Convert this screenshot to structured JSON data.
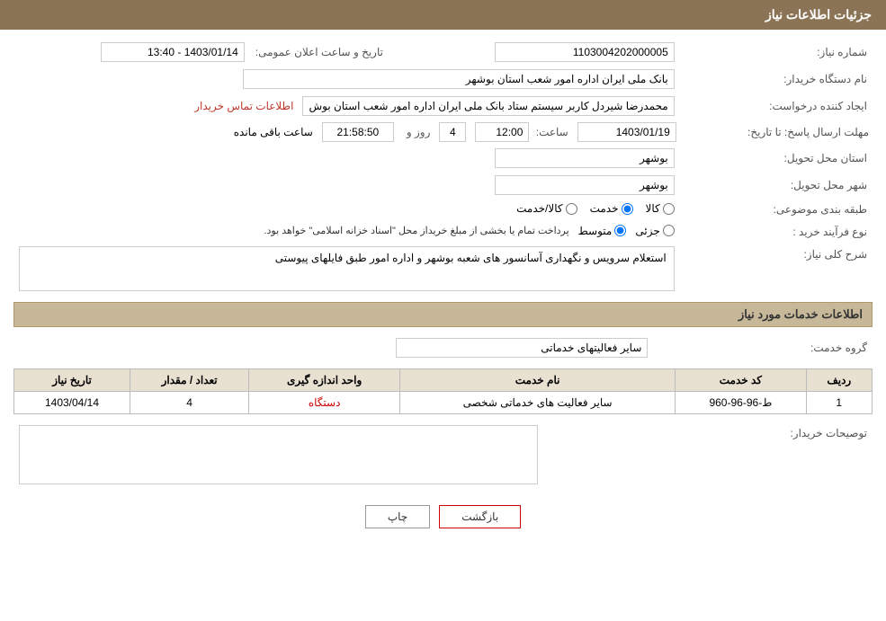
{
  "header": {
    "title": "جزئیات اطلاعات نیاز"
  },
  "fields": {
    "shomareNiaz_label": "شماره نیاز:",
    "shomareNiaz_value": "1103004202000005",
    "namDastgah_label": "نام دستگاه خریدار:",
    "namDastgah_value": "بانک ملی ایران اداره امور شعب استان بوشهر",
    "tarikhoSaat_label": "تاریخ و ساعت اعلان عمومی:",
    "tarikhoSaat_value": "1403/01/14 - 13:40",
    "ijadKonande_label": "ایجاد کننده درخواست:",
    "ijadKonande_value": "محمدرضا شیردل کاربر سیستم ستاد بانک ملی ایران اداره امور شعب استان بوش",
    "ijadKonande_link": "اطلاعات تماس خریدار",
    "mohlat_label": "مهلت ارسال پاسخ: تا تاریخ:",
    "mohlat_date": "1403/01/19",
    "mohlat_saat_label": "ساعت:",
    "mohlat_saat": "12:00",
    "mohlat_rooz_label": "روز و",
    "mohlat_rooz": "4",
    "mohlat_mande_label": "ساعت باقی مانده",
    "mohlat_mande": "21:58:50",
    "ostan_label": "استان محل تحویل:",
    "ostan_value": "بوشهر",
    "shahr_label": "شهر محل تحویل:",
    "shahr_value": "بوشهر",
    "tabaqeBandi_label": "طبقه بندی موضوعی:",
    "tabaqe_kala": "کالا",
    "tabaqe_khadamat": "خدمت",
    "tabaqe_kalaKhadamat": "کالا/خدمت",
    "tabaqe_selected": "khadamat",
    "noefarayand_label": "نوع فرآیند خرید :",
    "noefarayand_jazii": "جزئی",
    "noefarayand_motavaset": "متوسط",
    "noefarayand_note": "پرداخت تمام یا بخشی از مبلغ خریداز محل \"اسناد خزانه اسلامی\" خواهد بود.",
    "sharh_label": "شرح کلی نیاز:",
    "sharh_value": "استعلام سرویس و نگهداری آسانسور های شعبه بوشهر و اداره امور طبق فایلهای پیوستی",
    "khadamat_label": "اطلاعات خدمات مورد نیاز",
    "gorohe_label": "گروه خدمت:",
    "gorohe_value": "سایر فعالیتهای خدماتی",
    "services_cols": {
      "radif": "ردیف",
      "kodKhadamat": "کد خدمت",
      "namKhadamat": "نام خدمت",
      "vahedAndaze": "واحد اندازه گیری",
      "tedad": "تعداد / مقدار",
      "tarikhNiaz": "تاریخ نیاز"
    },
    "services_rows": [
      {
        "radif": "1",
        "kodKhadamat": "ط-96-96-960",
        "namKhadamat": "سایر فعالیت های خدماتی شخصی",
        "vahedAndaze": "دستگاه",
        "tedad": "4",
        "tarikhNiaz": "1403/04/14"
      }
    ],
    "tosaif_label": "توصیحات خریدار:",
    "tosaif_value": ""
  },
  "buttons": {
    "chap": "چاپ",
    "bazgasht": "بازگشت"
  }
}
